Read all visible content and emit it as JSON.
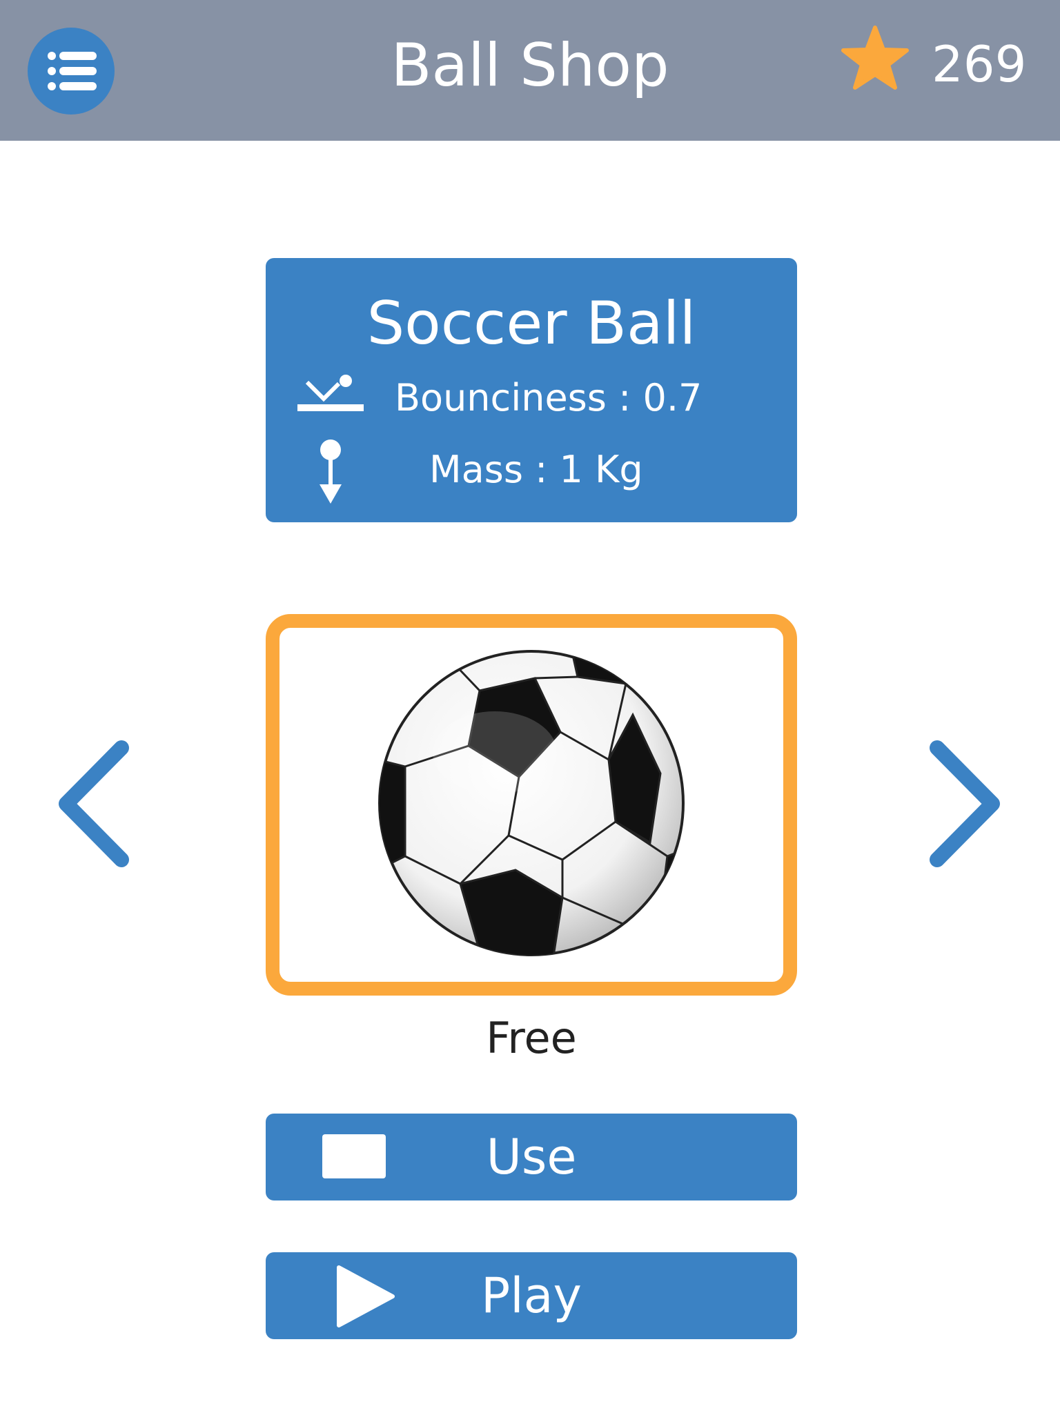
{
  "header": {
    "title": "Ball Shop",
    "stars": "269",
    "menu_icon": "list-icon",
    "star_icon": "star-icon"
  },
  "ball": {
    "name": "Soccer Ball",
    "bounciness": "Bounciness : 0.7",
    "mass": "Mass : 1 Kg",
    "price": "Free"
  },
  "buttons": {
    "use_label": "Use",
    "play_label": "Play"
  },
  "colors": {
    "header_bg": "#8792a5",
    "accent_blue": "#3b82c4",
    "frame_orange": "#fba83c",
    "star_orange": "#fba83c"
  }
}
